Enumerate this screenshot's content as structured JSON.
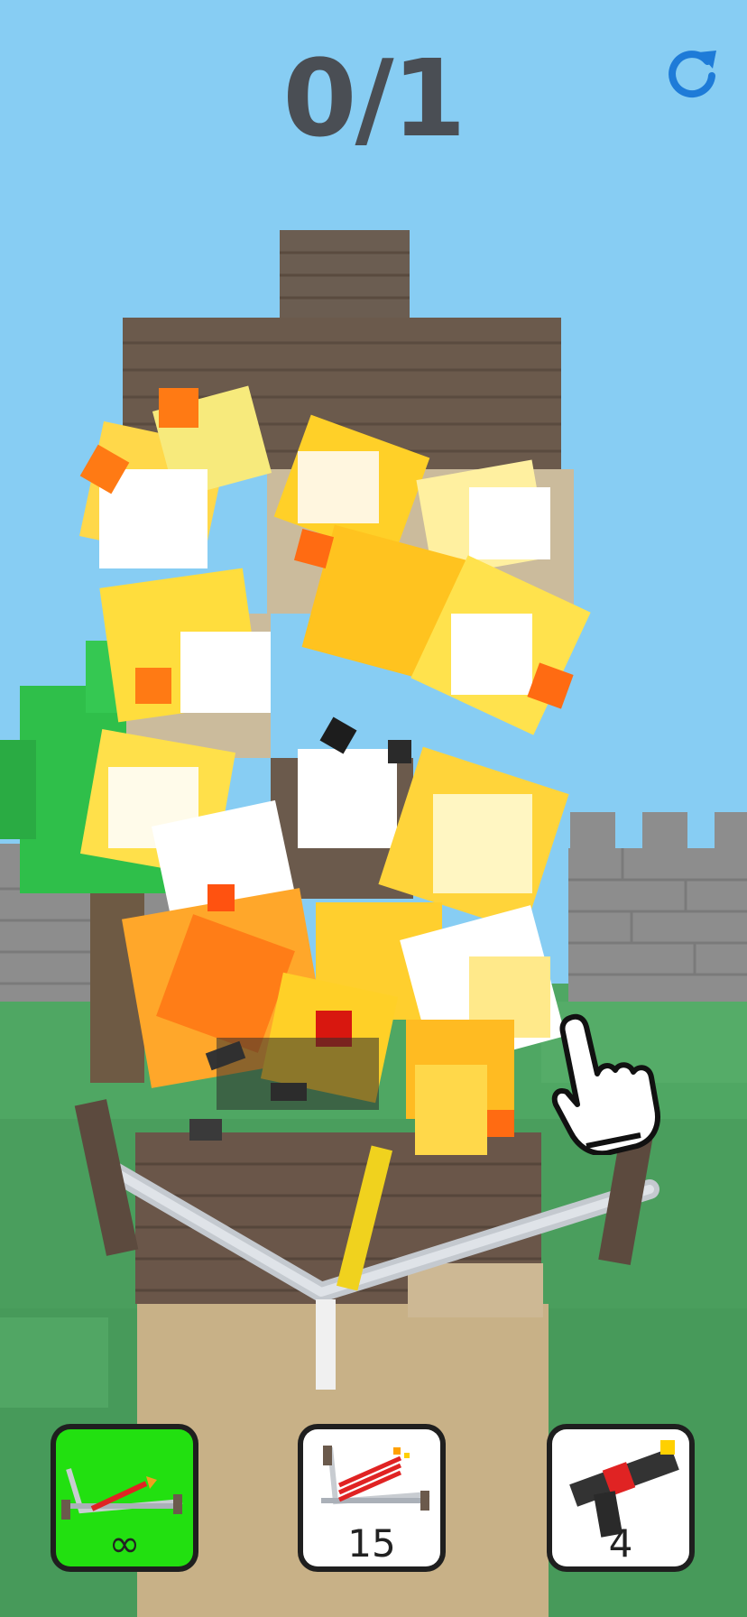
{
  "hud": {
    "counter_text": "0/1",
    "restart_icon": "restart-icon",
    "accent_color": "#1e7bd8"
  },
  "weapons": [
    {
      "name": "crossbow-basic",
      "count": "∞",
      "selected": true,
      "bg_color": "#22e010"
    },
    {
      "name": "crossbow-fire-multishot",
      "count": "15",
      "selected": false,
      "bg_color": "#ffffff"
    },
    {
      "name": "cannon",
      "count": "4",
      "selected": false,
      "bg_color": "#ffffff"
    }
  ],
  "tutorial": {
    "icon": "pointing-hand-icon"
  },
  "colors": {
    "sky": "#87cdf3",
    "grass": "#4fa763",
    "wood": "#6b5a4c",
    "sand": "#cbb48a",
    "stone": "#8a8a8a",
    "leaves": "#2fbf4a"
  }
}
